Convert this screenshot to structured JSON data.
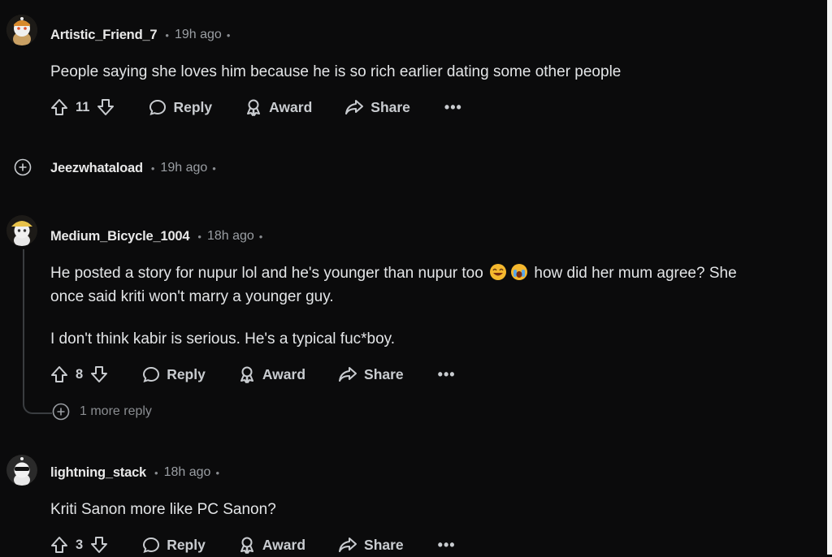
{
  "comments": [
    {
      "author": "Artistic_Friend_7",
      "time": "19h ago",
      "body": "People saying she loves him because he is so rich earlier dating some other people",
      "votes": "11"
    },
    {
      "author": "Jeezwhataload",
      "time": "19h ago"
    },
    {
      "author": "Medium_Bicycle_1004",
      "time": "18h ago",
      "body_line1": "He posted a story for nupur lol and he's younger than nupur too",
      "body_line1b": "how did her mum agree? She",
      "body_line2": "once said kriti won't marry a younger guy.",
      "body_para2": "I don't think kabir is serious. He's a typical fuc*boy.",
      "votes": "8",
      "more_replies": "1 more reply"
    },
    {
      "author": "lightning_stack",
      "time": "18h ago",
      "body": "Kriti Sanon more like PC Sanon?",
      "votes": "3"
    }
  ],
  "labels": {
    "reply": "Reply",
    "award": "Award",
    "share": "Share",
    "more": "•••",
    "separator": "•"
  },
  "colors": {
    "background": "#0b0b0c",
    "text": "#d7dadc",
    "meta": "#9a9ea3",
    "thread_line": "#3a3d40"
  }
}
